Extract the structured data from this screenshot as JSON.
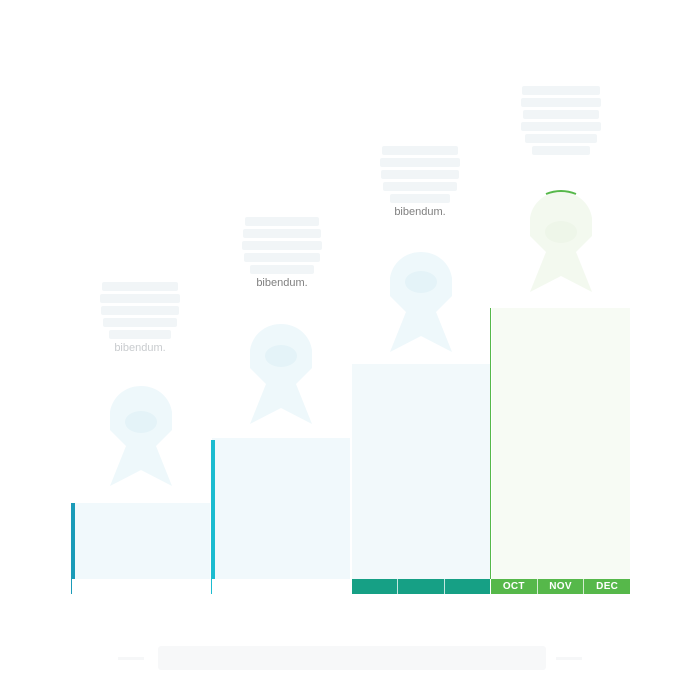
{
  "steps": [
    {
      "months": [
        "",
        "",
        ""
      ],
      "bar_color": "#d6f0f5",
      "fill_color": "#f1f9fc",
      "accent_color": "#1a9bb8",
      "text_tail": "bibendum."
    },
    {
      "months": [
        "",
        "",
        ""
      ],
      "bar_color": "#d6f0f5",
      "fill_color": "#f1f9fc",
      "accent_color": "#1bbcd0",
      "text_tail": "bibendum."
    },
    {
      "months": [
        "",
        "",
        ""
      ],
      "bar_color": "#16a085",
      "fill_color": "#f2f9fb",
      "accent_color": "#16a085",
      "text_tail": "bibendum."
    },
    {
      "months": [
        "OCT",
        "NOV",
        "DEC"
      ],
      "bar_color": "#56b84a",
      "fill_color": "#f7fbf4",
      "accent_color": "#56b84a",
      "text_tail": ""
    }
  ],
  "footer": {
    "title": ""
  }
}
